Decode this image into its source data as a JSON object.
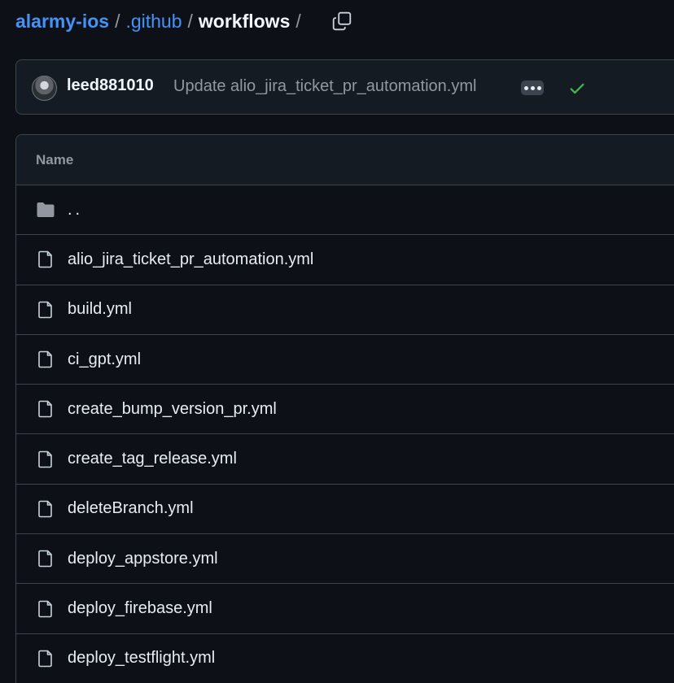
{
  "breadcrumb": {
    "repo": "alarmy-ios",
    "folder": ".github",
    "current": "workflows",
    "separator": "/"
  },
  "commit": {
    "author": "leed881010",
    "message": "Update alio_jira_ticket_pr_automation.yml",
    "status": "success"
  },
  "table": {
    "header_name": "Name",
    "parent_label": "..",
    "files": [
      "alio_jira_ticket_pr_automation.yml",
      "build.yml",
      "ci_gpt.yml",
      "create_bump_version_pr.yml",
      "create_tag_release.yml",
      "deleteBranch.yml",
      "deploy_appstore.yml",
      "deploy_firebase.yml",
      "deploy_testflight.yml"
    ]
  },
  "colors": {
    "background": "#0d1117",
    "link": "#4493f8",
    "border": "#3d444d",
    "success": "#3fb950",
    "muted": "#9198a1"
  },
  "icons": {
    "copy": "copy-icon",
    "folder": "folder-icon",
    "file": "file-icon",
    "check": "check-icon",
    "kebab": "ellipsis-icon"
  }
}
